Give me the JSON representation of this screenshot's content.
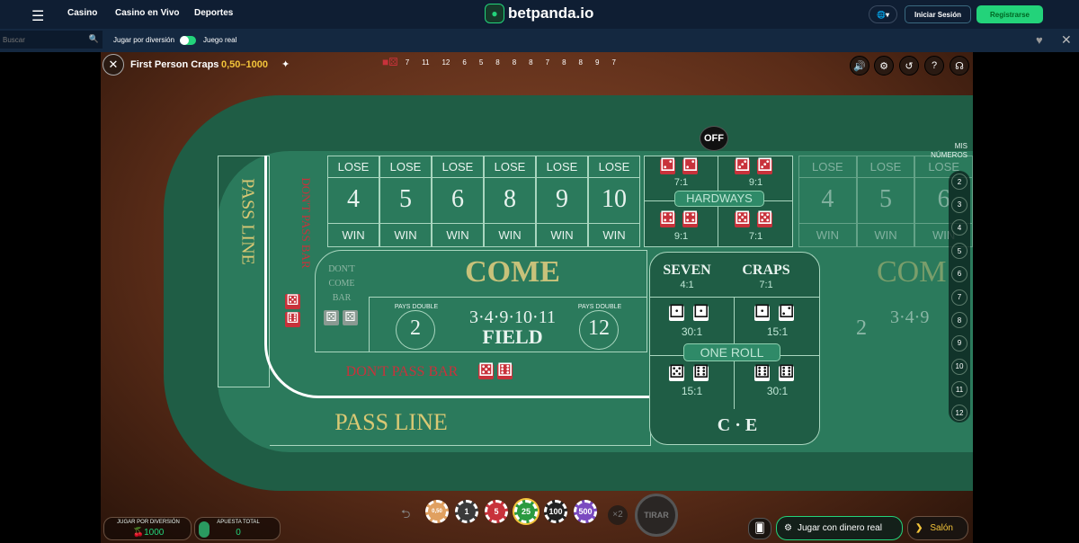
{
  "nav": {
    "links": [
      "Casino",
      "Casino en Vivo",
      "Deportes"
    ],
    "brand": "betpanda.io",
    "login": "Iniciar Sesión",
    "register": "Registrarse"
  },
  "subbar": {
    "search_placeholder": "Buscar",
    "fun_label": "Jugar por diversión",
    "real_label": "Juego real",
    "toggle_on": true
  },
  "game": {
    "title": "First Person Craps",
    "limits": "0,50–1000",
    "history": [
      "7",
      "11",
      "12",
      "6",
      "5",
      "8",
      "8",
      "8",
      "7",
      "8",
      "8",
      "9",
      "7"
    ],
    "off_label": "OFF"
  },
  "table": {
    "lose": "LOSE",
    "win": "WIN",
    "place_numbers": [
      "4",
      "5",
      "6",
      "8",
      "9",
      "10"
    ],
    "pass_line": "PASS LINE",
    "dont_pass_bar": "DON'T PASS BAR",
    "dont_come_bar": "DON'T COME BAR",
    "come": "COME",
    "field": "FIELD",
    "field_numbers": "3·4·9·10·11",
    "pays_double": "PAYS DOUBLE",
    "field_2": "2",
    "field_12": "12",
    "hardways": "HARDWAYS",
    "hard_odds": [
      "7:1",
      "9:1",
      "9:1",
      "7:1"
    ],
    "seven": "SEVEN",
    "seven_odds": "4:1",
    "craps": "CRAPS",
    "craps_odds": "7:1",
    "one_roll": "ONE ROLL",
    "one_roll_odds": [
      "30:1",
      "15:1",
      "15:1",
      "30:1"
    ],
    "ce": "C · E",
    "right_numbers": [
      "4",
      "5",
      "6"
    ],
    "right_come": "COM",
    "right_field": "3·4·9",
    "right_2": "2"
  },
  "mis_numeros": {
    "title": "MIS NÚMEROS",
    "numbers": [
      "2",
      "3",
      "4",
      "5",
      "6",
      "7",
      "8",
      "9",
      "10",
      "11",
      "12"
    ]
  },
  "bottom": {
    "fun_label": "JUGAR POR DIVERSIÓN",
    "balance": "1000",
    "bet_label": "APUESTA TOTAL",
    "bet": "0",
    "chips": [
      "0,50",
      "1",
      "5",
      "25",
      "100",
      "500"
    ],
    "double": "×2",
    "roll": "TIRAR",
    "real_money": "Jugar con dinero real",
    "lobby": "Salón",
    "selected_chip": "25"
  },
  "colors": {
    "accent": "#23d37a",
    "gold": "#f3c43a",
    "felt": "#2b7a5c"
  }
}
